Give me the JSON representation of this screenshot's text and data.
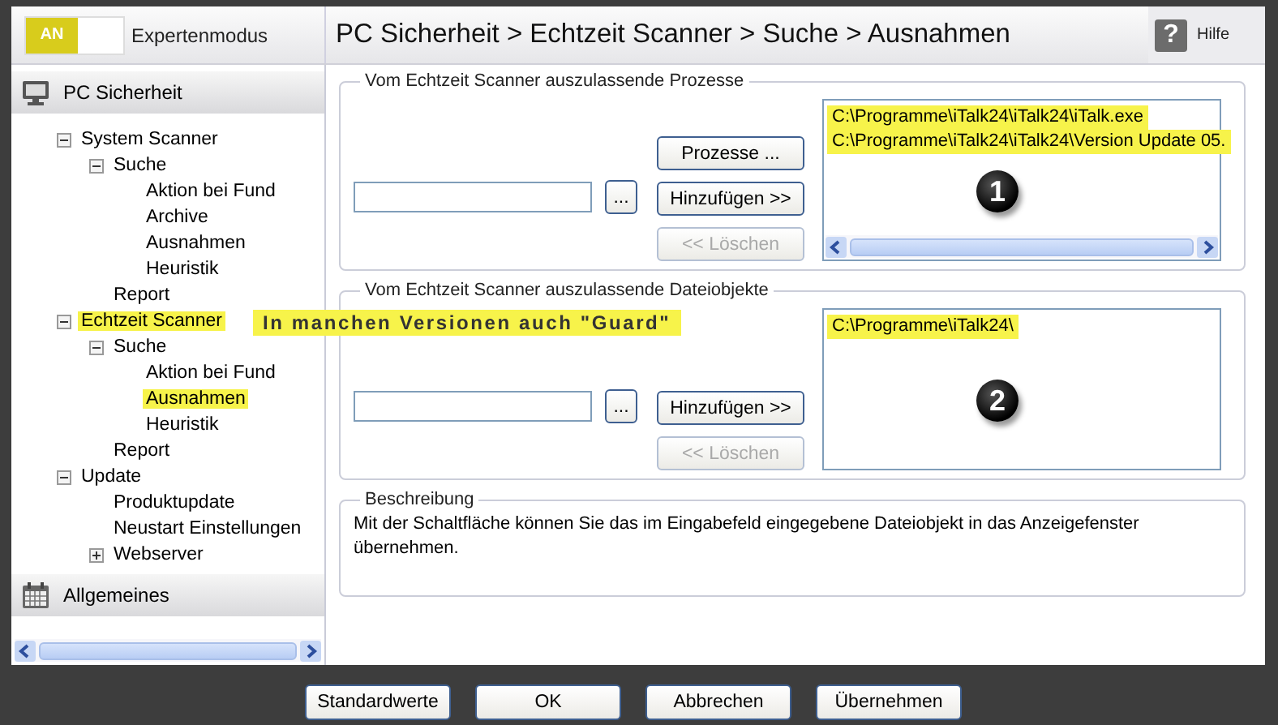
{
  "expert_mode": {
    "toggle_label": "AN",
    "on": true,
    "label": "Expertenmodus"
  },
  "breadcrumb": "PC Sicherheit > Echtzeit Scanner > Suche > Ausnahmen",
  "help": {
    "icon": "?",
    "label": "Hilfe"
  },
  "sidebar": {
    "sections": [
      {
        "title": "PC Sicherheit",
        "kind": "monitor",
        "tree": [
          {
            "label": "System Scanner",
            "expanded": true,
            "highlighted": false,
            "children": [
              {
                "label": "Suche",
                "expanded": true,
                "highlighted": false,
                "children": [
                  {
                    "label": "Aktion bei Fund",
                    "highlighted": false
                  },
                  {
                    "label": "Archive",
                    "highlighted": false
                  },
                  {
                    "label": "Ausnahmen",
                    "highlighted": false
                  },
                  {
                    "label": "Heuristik",
                    "highlighted": false
                  }
                ]
              },
              {
                "label": "Report",
                "highlighted": false
              }
            ]
          },
          {
            "label": "Echtzeit Scanner",
            "expanded": true,
            "highlighted": true,
            "children": [
              {
                "label": "Suche",
                "expanded": true,
                "highlighted": false,
                "children": [
                  {
                    "label": "Aktion bei Fund",
                    "highlighted": false
                  },
                  {
                    "label": "Ausnahmen",
                    "highlighted": true
                  },
                  {
                    "label": "Heuristik",
                    "highlighted": false
                  }
                ]
              },
              {
                "label": "Report",
                "highlighted": false
              }
            ]
          },
          {
            "label": "Update",
            "expanded": true,
            "highlighted": false,
            "children": [
              {
                "label": "Produktupdate",
                "highlighted": false
              },
              {
                "label": "Neustart Einstellungen",
                "highlighted": false
              },
              {
                "label": "Webserver",
                "expanded": false,
                "highlighted": false
              }
            ]
          }
        ]
      },
      {
        "title": "Allgemeines",
        "kind": "calendar"
      }
    ]
  },
  "groups": [
    {
      "title": "Vom Echtzeit Scanner auszulassende Prozesse",
      "browse_label": "...",
      "buttons": [
        {
          "label": "Prozesse ...",
          "disabled": false
        },
        {
          "label": "Hinzufügen >>",
          "disabled": false
        },
        {
          "label": "<< Löschen",
          "disabled": true
        }
      ],
      "list": {
        "items": [
          {
            "text": "C:\\Programme\\iTalk24\\iTalk24\\iTalk.exe",
            "highlighted": true
          },
          {
            "text": "C:\\Programme\\iTalk24\\iTalk24\\Version Update 05.",
            "highlighted": true
          }
        ],
        "marker": "1",
        "horizontal_scrollbar": true
      }
    },
    {
      "title": "Vom Echtzeit Scanner auszulassende Dateiobjekte",
      "browse_label": "...",
      "buttons": [
        {
          "label": "Hinzufügen >>",
          "disabled": false
        },
        {
          "label": "<< Löschen",
          "disabled": true
        }
      ],
      "list": {
        "items": [
          {
            "text": "C:\\Programme\\iTalk24\\",
            "highlighted": true
          }
        ],
        "marker": "2",
        "horizontal_scrollbar": false
      }
    }
  ],
  "description": {
    "title": "Beschreibung",
    "text": "Mit der Schaltfläche können Sie das im Eingabefeld eingegebene Dateiobjekt in das Anzeigefenster übernehmen."
  },
  "annotation": {
    "text": "In manchen Versionen auch \"Guard\""
  },
  "buttons": [
    {
      "label": "Standardwerte"
    },
    {
      "label": "OK"
    },
    {
      "label": "Abbrechen"
    },
    {
      "label": "Übernehmen"
    }
  ]
}
